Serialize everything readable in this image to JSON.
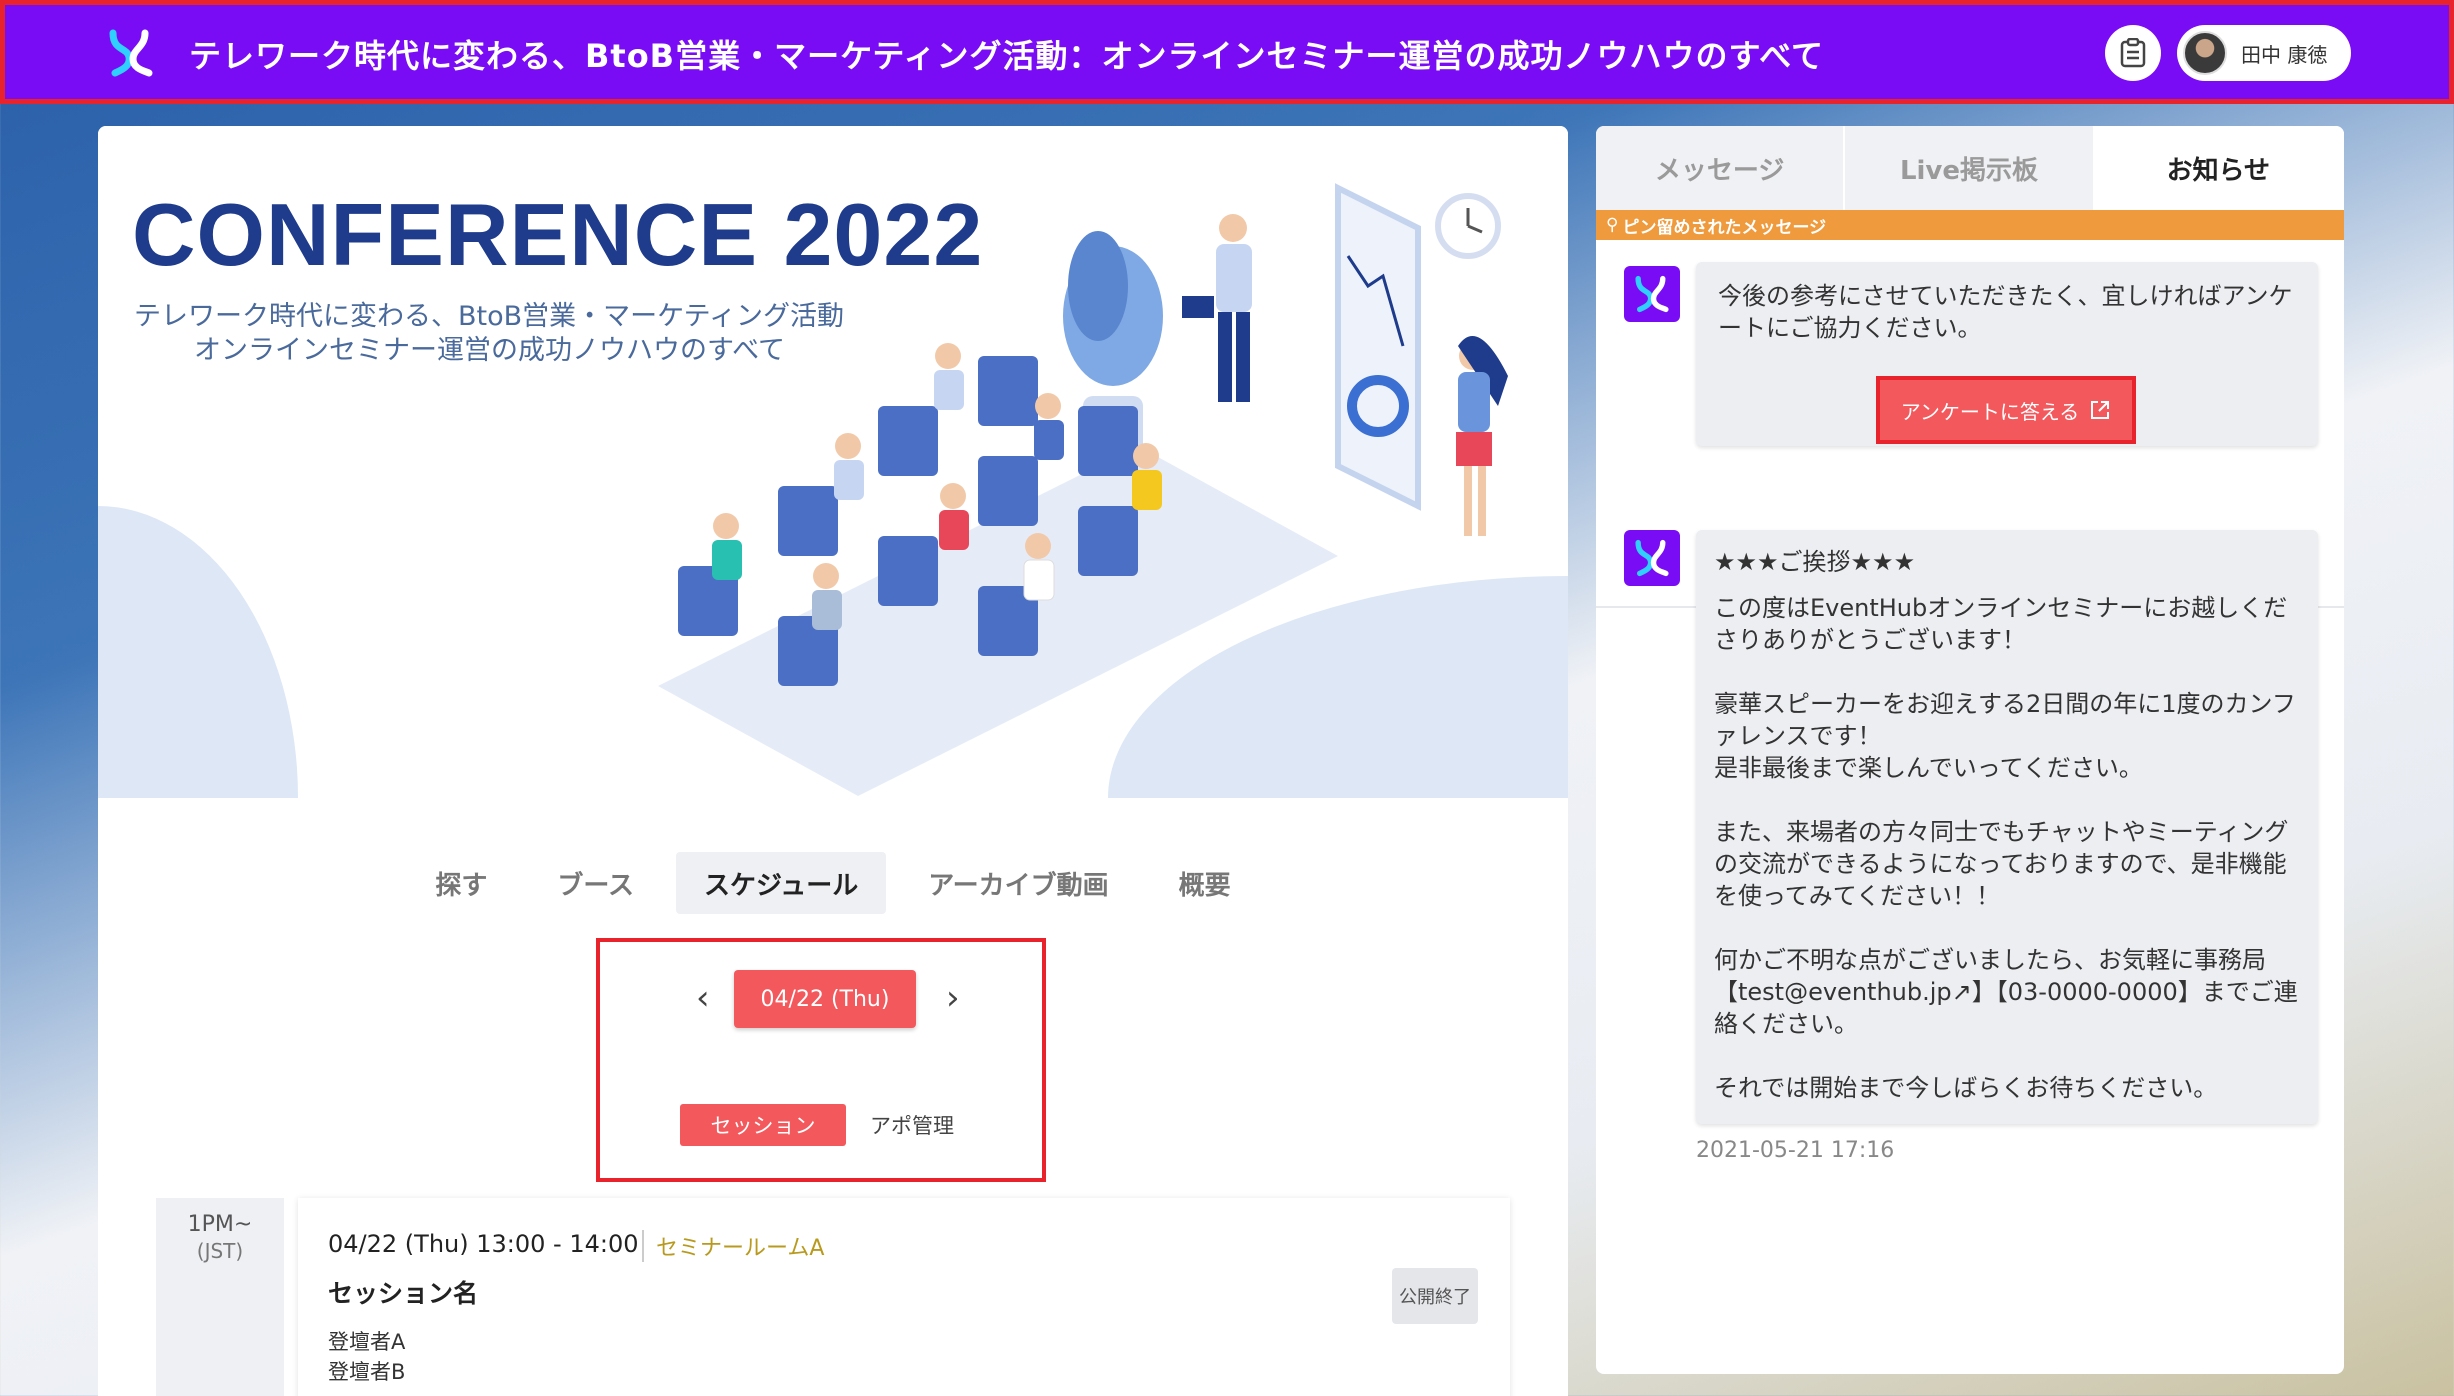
{
  "header": {
    "title": "テレワーク時代に変わる、BtoB営業・マーケティング活動：オンラインセミナー運営の成功ノウハウのすべて",
    "user_name": "田中 康徳"
  },
  "hero": {
    "title": "CONFERENCE 2022",
    "subtitle_line1": "テレワーク時代に変わる、BtoB営業・マーケティング活動",
    "subtitle_line2": "オンラインセミナー運営の成功ノウハウのすべて"
  },
  "tabs": [
    {
      "label": "探す"
    },
    {
      "label": "ブース"
    },
    {
      "label": "スケジュール",
      "active": true
    },
    {
      "label": "アーカイブ動画"
    },
    {
      "label": "概要"
    }
  ],
  "schedule": {
    "date": "04/22 (Thu)",
    "session_tab": "セッション",
    "appointment_tab": "アポ管理",
    "time_main": "1PM~",
    "time_tz": "(JST)",
    "session": {
      "time": "04/22 (Thu) 13:00 - 14:00",
      "room": "セミナールームA",
      "name": "セッション名",
      "speaker1": "登壇者A",
      "speaker2": "登壇者B",
      "status": "公開終了"
    }
  },
  "side": {
    "tabs": [
      {
        "label": "メッセージ"
      },
      {
        "label": "Live掲示板"
      },
      {
        "label": "お知らせ",
        "active": true
      }
    ],
    "pinned_label": "ピン留めされたメッセージ",
    "pinned_message": "今後の参考にさせていただきたく、宜しければアンケートにご協力ください。",
    "survey_button": "アンケートに答える",
    "message_title": "★★★ご挨拶★★★",
    "message_body": "この度はEventHubオンラインセミナーにお越しくださりありがとうございます！\n\n豪華スピーカーをお迎えする2日間の年に1度のカンファレンスです！\n是非最後まで楽しんでいってください。\n\nまた、来場者の方々同士でもチャットやミーティングの交流ができるようになっておりますので、是非機能を使ってみてください！！\n\n何かご不明な点がございましたら、お気軽に事務局【test@eventhub.jp↗】【03-0000-0000】までご連絡ください。\n\nそれでは開始まで今しばらくお待ちください。",
    "message_time": "2021-05-21 17:16"
  },
  "colors": {
    "header": "#7a0cf5",
    "accent": "#f3595c",
    "pin_bar": "#ee9a3d",
    "hero_title": "#1e3b8c"
  }
}
